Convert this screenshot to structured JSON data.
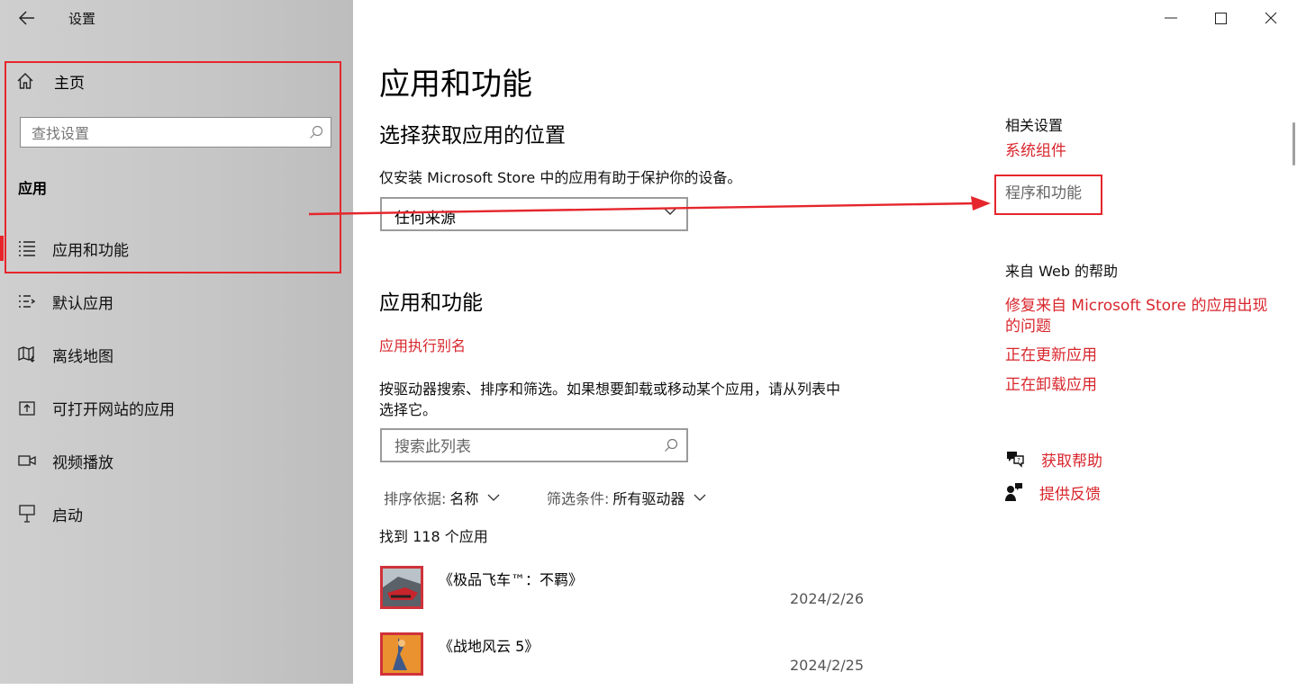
{
  "window": {
    "title": "设置",
    "controls": [
      "minimize",
      "maximize",
      "close"
    ]
  },
  "sidebar": {
    "home_label": "主页",
    "search_placeholder": "查找设置",
    "section_label": "应用",
    "items": [
      {
        "label": "应用和功能",
        "icon": "apps-features-list-icon",
        "active": true
      },
      {
        "label": "默认应用",
        "icon": "default-apps-icon",
        "active": false
      },
      {
        "label": "离线地图",
        "icon": "offline-maps-icon",
        "active": false
      },
      {
        "label": "可打开网站的应用",
        "icon": "apps-for-websites-icon",
        "active": false
      },
      {
        "label": "视频播放",
        "icon": "video-playback-icon",
        "active": false
      },
      {
        "label": "启动",
        "icon": "startup-icon",
        "active": false
      }
    ]
  },
  "main": {
    "title": "应用和功能",
    "source_section": {
      "heading": "选择获取应用的位置",
      "description": "仅安装 Microsoft Store 中的应用有助于保护你的设备。",
      "dropdown_value": "任何来源"
    },
    "apps_section": {
      "heading": "应用和功能",
      "alias_link": "应用执行别名",
      "description_line1": "按驱动器搜索、排序和筛选。如果想要卸载或移动某个应用，请从列表中",
      "description_line2": "选择它。",
      "search_placeholder": "搜索此列表",
      "sort_label": "排序依据:",
      "sort_value": "名称",
      "filter_label": "筛选条件:",
      "filter_value": "所有驱动器",
      "count_text": "找到 118 个应用",
      "apps": [
        {
          "name": "《极品飞车™：不羁》",
          "date": "2024/2/26"
        },
        {
          "name": "《战地风云 5》",
          "date": "2024/2/25"
        }
      ]
    }
  },
  "related": {
    "heading": "相关设置",
    "links": [
      "系统组件",
      "程序和功能"
    ],
    "web_help_heading": "来自 Web 的帮助",
    "web_help_links": [
      {
        "line1": "修复来自 Microsoft Store 的应用出现",
        "line2": "的问题"
      },
      {
        "line1": "正在更新应用"
      },
      {
        "line1": "正在卸载应用"
      }
    ],
    "get_help": "获取帮助",
    "feedback": "提供反馈"
  },
  "colors": {
    "accent": "#d8262d",
    "annotation": "#e5262c",
    "sidebar_bg": "#c8c8c8"
  }
}
